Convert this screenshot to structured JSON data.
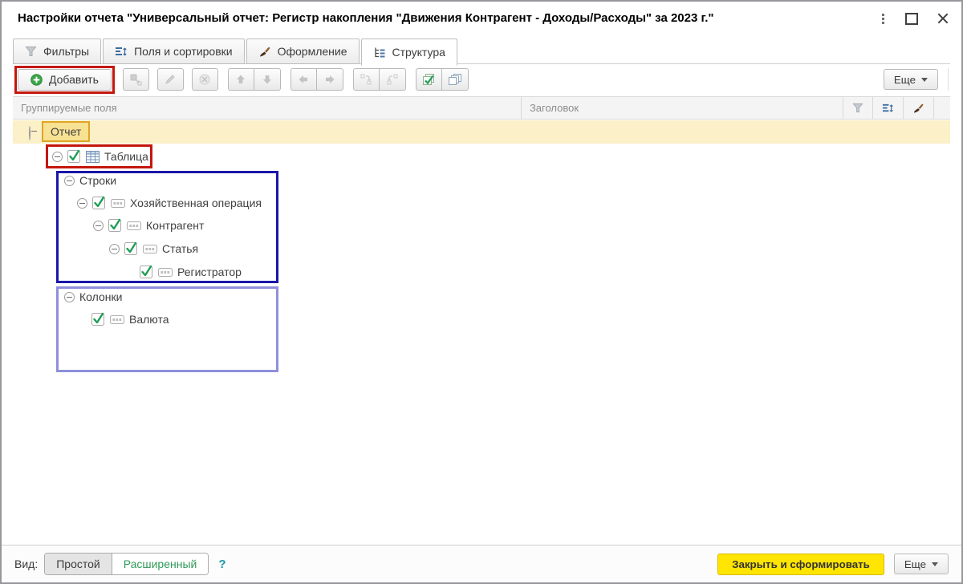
{
  "window": {
    "title": "Настройки отчета \"Универсальный отчет: Регистр накопления \"Движения Контрагент - Доходы/Расходы\" за 2023 г.\""
  },
  "tabs": [
    {
      "label": "Фильтры",
      "icon": "funnel-icon",
      "active": false
    },
    {
      "label": "Поля и сортировки",
      "icon": "sort-icon",
      "active": false
    },
    {
      "label": "Оформление",
      "icon": "brush-icon",
      "active": false
    },
    {
      "label": "Структура",
      "icon": "structure-icon",
      "active": true
    }
  ],
  "toolbar": {
    "add_label": "Добавить",
    "more_label": "Еще",
    "icons": [
      "add-icon",
      "move-to-group-icon",
      "edit-icon",
      "disable-icon",
      "move-up-icon",
      "move-down-icon",
      "move-left-icon",
      "move-right-icon",
      "move-into-group-icon",
      "move-out-of-group-icon",
      "check-all-icon",
      "uncheck-all-icon"
    ]
  },
  "grid": {
    "columns": [
      {
        "label": "Группируемые поля"
      },
      {
        "label": "Заголовок"
      }
    ],
    "header_icons": [
      "funnel-icon",
      "sort-icon",
      "brush-icon"
    ]
  },
  "tree": {
    "rows": [
      {
        "label": "Отчет"
      },
      {
        "label": "Таблица"
      },
      {
        "label": "Строки"
      },
      {
        "label": "Хозяйственная операция"
      },
      {
        "label": "Контрагент"
      },
      {
        "label": "Статья"
      },
      {
        "label": "Регистратор"
      },
      {
        "label": "Колонки"
      },
      {
        "label": "Валюта"
      }
    ]
  },
  "footer": {
    "view_label": "Вид:",
    "mode_simple": "Простой",
    "mode_extended": "Расширенный",
    "help": "?",
    "close_generate": "Закрыть и сформировать",
    "more_label": "Еще"
  },
  "colors": {
    "annotation_red": "#C4170C",
    "annotation_navy": "#1A16A8",
    "annotation_purple": "#8F8FDC",
    "annotation_gold": "#DFA526",
    "report_row_bg": "#FBF0C8",
    "accent_green": "#1F9D55",
    "extended_mode_green": "#2E9B57",
    "primary_button_bg": "#FFE500"
  }
}
